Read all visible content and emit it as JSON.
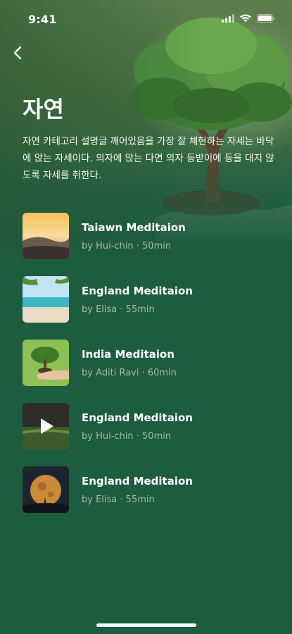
{
  "status": {
    "time": "9:41"
  },
  "header": {
    "title": "자연",
    "description": "자연 카테고리 설명글 깨어있음을 가장 잘 체현하는 자세는 바닥에 앉는 자세이다. 의자에 앉는 다면 의자 등받이에 등을 대지 않도록  자세를 취한다."
  },
  "meditations": [
    {
      "title": "Taiawn Meditaion",
      "subtitle": "by Hui-chin · 50min",
      "thumb": "sunset-landscape"
    },
    {
      "title": "England Meditaion",
      "subtitle": "by Elisa · 55min",
      "thumb": "beach-sea"
    },
    {
      "title": "India Meditaion",
      "subtitle": "by Aditi Ravi · 60min",
      "thumb": "tree-in-hand"
    },
    {
      "title": "England Meditaion",
      "subtitle": "by Hui-chin · 50min",
      "thumb": "video-play"
    },
    {
      "title": "England Meditaion",
      "subtitle": "by Elisa · 55min",
      "thumb": "moon-night"
    }
  ],
  "colors": {
    "background": "#1d5c3f",
    "subtitle": "#9fbca9"
  }
}
